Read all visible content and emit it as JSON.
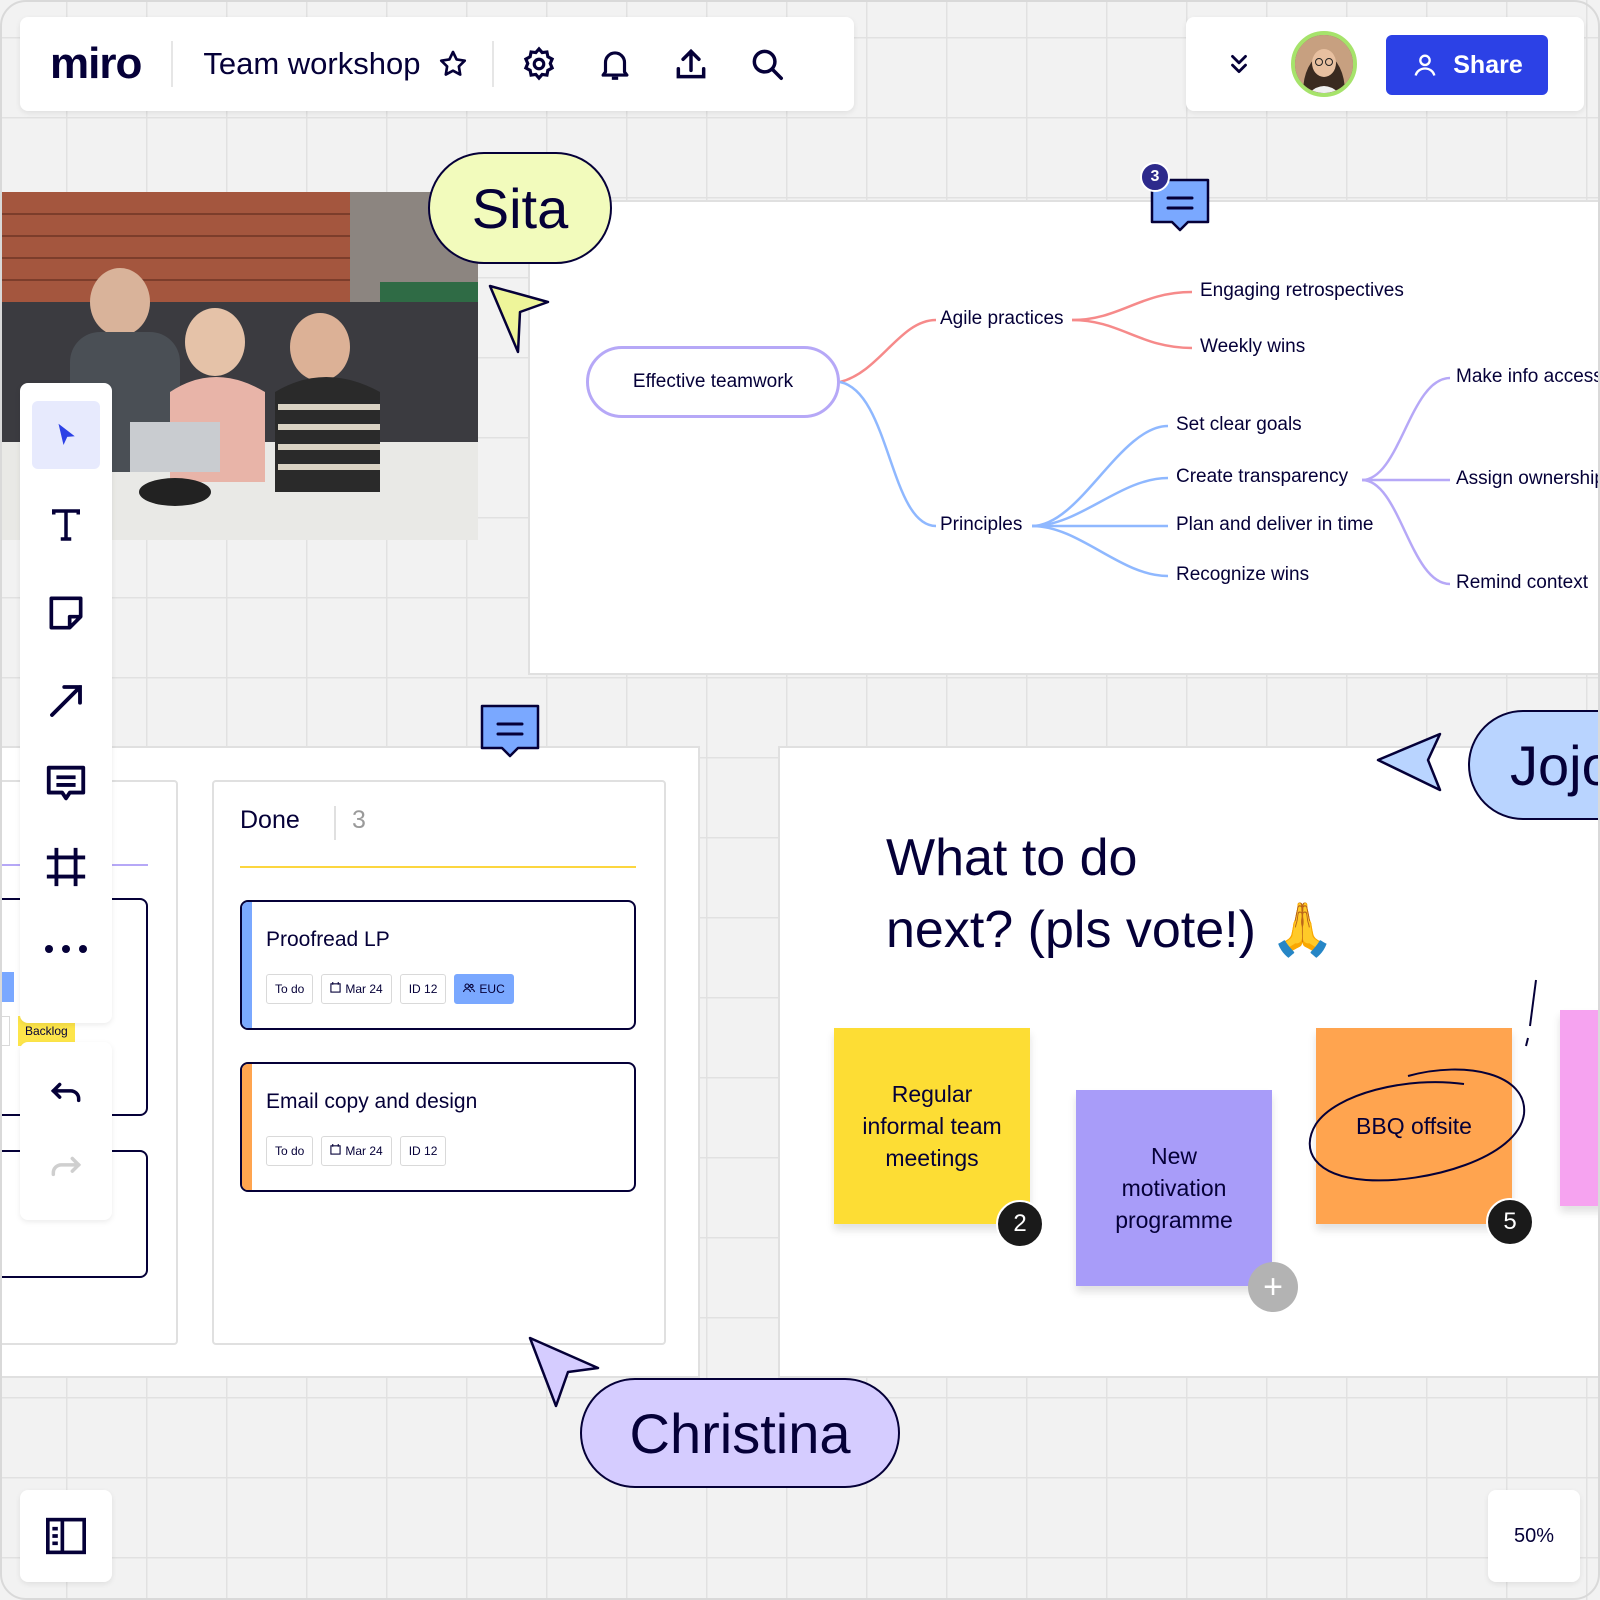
{
  "app": {
    "logo": "miro",
    "board_title": "Team workshop"
  },
  "header": {
    "icons": [
      "star-icon",
      "settings-icon",
      "bell-icon",
      "upload-icon",
      "search-icon"
    ],
    "share_label": "Share",
    "collapse_icon": "double-chevron-down-icon"
  },
  "toolbar": {
    "tools": [
      "select-tool",
      "text-tool",
      "sticky-note-tool",
      "arrow-tool",
      "comment-tool",
      "frame-tool",
      "more-tool"
    ],
    "undo": "undo-icon",
    "redo": "redo-icon"
  },
  "collaborators": {
    "sita": "Sita",
    "christina": "Christina",
    "jojo": "Jojo"
  },
  "comments": {
    "mindmap_count": "3"
  },
  "mindmap": {
    "root": "Effective teamwork",
    "branch1": "Agile practices",
    "branch1_children": [
      "Engaging retrospectives",
      "Weekly wins"
    ],
    "branch2": "Principles",
    "branch2_children": [
      "Set clear goals",
      "Create transparency",
      "Plan and deliver in time",
      "Recognize wins"
    ],
    "transparency_children": [
      "Make info accessible",
      "Assign ownership",
      "Remind context"
    ]
  },
  "kanban": {
    "column_title": "Done",
    "column_count": "3",
    "backlog_tag": "Backlog",
    "cards": [
      {
        "title": "Proofread LP",
        "status": "To do",
        "date": "Mar 24",
        "id": "ID 12",
        "team": "EUC"
      },
      {
        "title": "Email copy and design",
        "status": "To do",
        "date": "Mar 24",
        "id": "ID 12"
      }
    ]
  },
  "vote": {
    "title_line1": "What to do",
    "title_line2": "next? (pls vote!) 🙏",
    "stickies": [
      {
        "text": "Regular informal team meetings",
        "votes": "2",
        "color": "#fddd34"
      },
      {
        "text": "New motivation programme",
        "color": "#a89cf9"
      },
      {
        "text": "BBQ offsite",
        "votes": "5",
        "color": "#ffa44f"
      }
    ]
  },
  "zoom": "50%",
  "colors": {
    "accent": "#2c41e6",
    "canvas": "#f2f2f2"
  }
}
